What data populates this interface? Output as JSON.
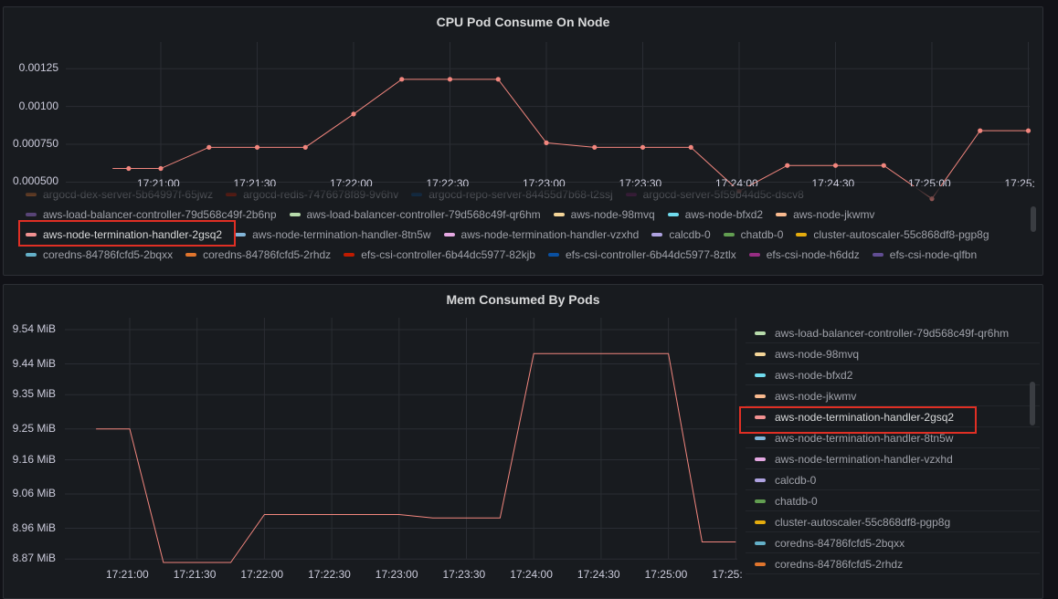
{
  "cpu_panel": {
    "title": "CPU Pod Consume On Node",
    "chart_data": {
      "type": "line",
      "title": "CPU Pod Consume On Node",
      "xlabel": "",
      "ylabel": "",
      "x_ticks": [
        "17:21:00",
        "17:21:30",
        "17:22:00",
        "17:22:30",
        "17:23:00",
        "17:23:30",
        "17:24:00",
        "17:24:30",
        "17:25:00",
        "17:25:"
      ],
      "y_ticks": [
        "0.00125",
        "0.00100",
        "0.000750",
        "0.000500"
      ],
      "ylim": [
        0.0004,
        0.00136
      ],
      "series": [
        {
          "name": "aws-node-termination-handler-2gsq2",
          "color": "#f2867e",
          "x": [
            "17:20:45",
            "17:20:50",
            "17:21:00",
            "17:21:15",
            "17:21:30",
            "17:21:45",
            "17:22:00",
            "17:22:15",
            "17:22:30",
            "17:22:45",
            "17:23:00",
            "17:23:15",
            "17:23:30",
            "17:23:45",
            "17:24:00",
            "17:24:15",
            "17:24:30",
            "17:24:45",
            "17:25:00",
            "17:25:15",
            "17:25:30"
          ],
          "values": [
            0.00059,
            0.00059,
            0.00059,
            0.00073,
            0.00073,
            0.00073,
            0.00095,
            0.00118,
            0.00118,
            0.00118,
            0.00076,
            0.00073,
            0.00073,
            0.00073,
            0.00044,
            0.00061,
            0.00061,
            0.00061,
            0.00039,
            0.00084,
            0.00084
          ],
          "marker_from": 1
        }
      ],
      "legend_position": "bottom",
      "grid": true
    },
    "legend_items": [
      {
        "label": "argocd-dex-server-5b64997f-65jwz",
        "color": "#e0752d"
      },
      {
        "label": "argocd-redis-7476678f89-9v6hv",
        "color": "#bf1b00"
      },
      {
        "label": "argocd-repo-server-84455d7b68-t2ssj",
        "color": "#0a437c"
      },
      {
        "label": "argocd-server-5f59b44d5c-dscv8",
        "color": "#6d1f62"
      },
      {
        "label": "aws-load-balancer-controller-79d568c49f-2b6np",
        "color": "#584477"
      },
      {
        "label": "aws-load-balancer-controller-79d568c49f-qr6hm",
        "color": "#b7dbab"
      },
      {
        "label": "aws-node-98mvq",
        "color": "#f4d598"
      },
      {
        "label": "aws-node-bfxd2",
        "color": "#70dbed"
      },
      {
        "label": "aws-node-jkwmv",
        "color": "#f9ba8f"
      },
      {
        "label": "aws-node-termination-handler-2gsq2",
        "color": "#f29191"
      },
      {
        "label": "aws-node-termination-handler-8tn5w",
        "color": "#82b5d8"
      },
      {
        "label": "aws-node-termination-handler-vzxhd",
        "color": "#e5a8e2"
      },
      {
        "label": "calcdb-0",
        "color": "#aea2e0"
      },
      {
        "label": "chatdb-0",
        "color": "#629e51"
      },
      {
        "label": "cluster-autoscaler-55c868df8-pgp8g",
        "color": "#e5ac0e"
      },
      {
        "label": "coredns-84786fcfd5-2bqxx",
        "color": "#64b0c8"
      },
      {
        "label": "coredns-84786fcfd5-2rhdz",
        "color": "#e0752d"
      },
      {
        "label": "efs-csi-controller-6b44dc5977-82kjb",
        "color": "#bf1b00"
      },
      {
        "label": "efs-csi-controller-6b44dc5977-8ztlx",
        "color": "#0a50a1"
      },
      {
        "label": "efs-csi-node-h6ddz",
        "color": "#962d82"
      },
      {
        "label": "efs-csi-node-qlfbn",
        "color": "#614d93"
      }
    ]
  },
  "mem_panel": {
    "title": "Mem Consumed By Pods",
    "chart_data": {
      "type": "line",
      "title": "Mem Consumed By Pods",
      "xlabel": "",
      "ylabel": "",
      "x_ticks": [
        "17:21:00",
        "17:21:30",
        "17:22:00",
        "17:22:30",
        "17:23:00",
        "17:23:30",
        "17:24:00",
        "17:24:30",
        "17:25:00",
        "17:25:"
      ],
      "y_ticks": [
        "9.54 MiB",
        "9.44 MiB",
        "9.35 MiB",
        "9.25 MiB",
        "9.16 MiB",
        "9.06 MiB",
        "8.96 MiB",
        "8.87 MiB"
      ],
      "ylim": [
        8.78,
        9.58
      ],
      "series": [
        {
          "name": "aws-node-termination-handler-2gsq2",
          "color": "#f2867e",
          "x": [
            "17:20:45",
            "17:21:00",
            "17:21:15",
            "17:21:30",
            "17:21:45",
            "17:22:00",
            "17:22:15",
            "17:22:30",
            "17:22:45",
            "17:23:00",
            "17:23:15",
            "17:23:30",
            "17:23:45",
            "17:24:00",
            "17:24:15",
            "17:24:30",
            "17:24:45",
            "17:25:00",
            "17:25:15",
            "17:25:30"
          ],
          "values": [
            9.25,
            9.25,
            8.86,
            8.86,
            8.86,
            9.0,
            9.0,
            9.0,
            9.0,
            9.0,
            8.99,
            8.99,
            8.99,
            9.47,
            9.47,
            9.47,
            9.47,
            9.47,
            8.92,
            8.92
          ]
        }
      ],
      "legend_position": "right",
      "grid": true
    },
    "legend_items": [
      {
        "label": "aws-load-balancer-controller-79d568c49f-qr6hm",
        "color": "#b7dbab"
      },
      {
        "label": "aws-node-98mvq",
        "color": "#f4d598"
      },
      {
        "label": "aws-node-bfxd2",
        "color": "#70dbed"
      },
      {
        "label": "aws-node-jkwmv",
        "color": "#f9ba8f"
      },
      {
        "label": "aws-node-termination-handler-2gsq2",
        "color": "#f29191"
      },
      {
        "label": "aws-node-termination-handler-8tn5w",
        "color": "#82b5d8"
      },
      {
        "label": "aws-node-termination-handler-vzxhd",
        "color": "#e5a8e2"
      },
      {
        "label": "calcdb-0",
        "color": "#aea2e0"
      },
      {
        "label": "chatdb-0",
        "color": "#629e51"
      },
      {
        "label": "cluster-autoscaler-55c868df8-pgp8g",
        "color": "#e5ac0e"
      },
      {
        "label": "coredns-84786fcfd5-2bqxx",
        "color": "#64b0c8"
      },
      {
        "label": "coredns-84786fcfd5-2rhdz",
        "color": "#e0752d"
      }
    ]
  }
}
